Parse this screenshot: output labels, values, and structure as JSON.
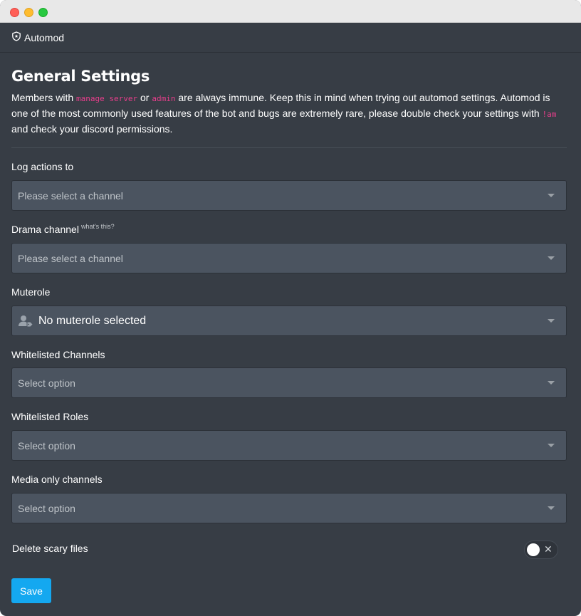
{
  "app": {
    "title": "Automod"
  },
  "settings": {
    "heading": "General Settings",
    "description": {
      "part1": "Members with ",
      "code1": "manage server",
      "part2": " or ",
      "code2": "admin",
      "part3": " are always immune. Keep this in mind when trying out automod settings. Automod is one of the most commonly used features of the bot and bugs are extremely rare, please double check your settings with ",
      "code3": "!am",
      "part4": " and check your discord permissions."
    },
    "fields": {
      "log_actions": {
        "label": "Log actions to",
        "value": "Please select a channel"
      },
      "drama_channel": {
        "label": "Drama channel",
        "hint": "what's this?",
        "value": "Please select a channel"
      },
      "muterole": {
        "label": "Muterole",
        "value": "No muterole selected"
      },
      "whitelisted_channels": {
        "label": "Whitelisted Channels",
        "value": "Select option"
      },
      "whitelisted_roles": {
        "label": "Whitelisted Roles",
        "value": "Select option"
      },
      "media_only_channels": {
        "label": "Media only channels",
        "value": "Select option"
      },
      "delete_scary_files": {
        "label": "Delete scary files",
        "enabled": false,
        "off_symbol": "✕"
      }
    },
    "save_label": "Save"
  },
  "colors": {
    "background": "#373d45",
    "input_bg": "#4b5460",
    "accent": "#14a8f0",
    "code": "#e83e8c"
  },
  "icons": {
    "app": "shield-icon",
    "role": "user-tag-icon",
    "dropdown": "caret-down-icon"
  }
}
